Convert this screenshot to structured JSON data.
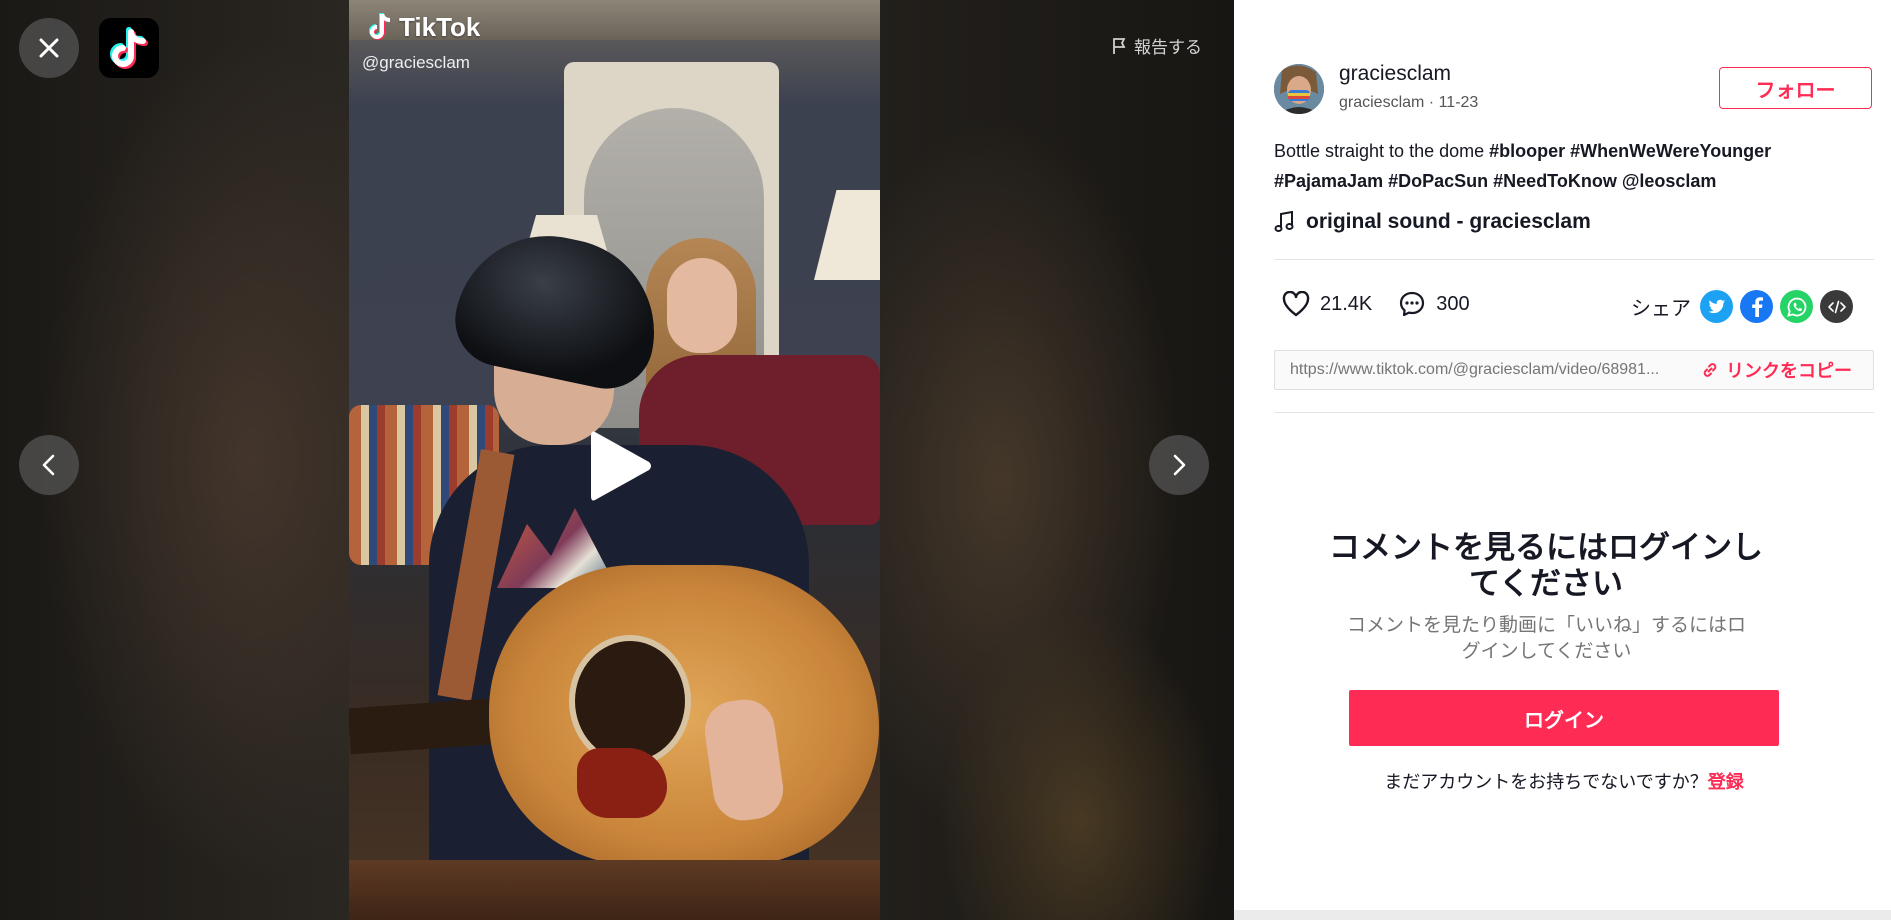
{
  "video": {
    "brand": "TikTok",
    "handle": "@graciesclam"
  },
  "report_label": "報告する",
  "author": {
    "username": "graciesclam",
    "subline": "graciesclam · 11-23",
    "follow_label": "フォロー"
  },
  "caption": {
    "text": "Bottle straight to the dome ",
    "tags": [
      "#blooper",
      "#WhenWeWereYounger",
      "#PajamaJam",
      "#DoPacSun",
      "#NeedToKnow",
      "@leosclam"
    ]
  },
  "sound": "original sound - graciesclam",
  "stats": {
    "likes": "21.4K",
    "comments": "300"
  },
  "share": {
    "label": "シェア",
    "icons": [
      "twitter-icon",
      "facebook-icon",
      "whatsapp-icon",
      "embed-icon"
    ],
    "colors": {
      "twitter": "#1da1f2",
      "facebook": "#1877f2",
      "whatsapp": "#25d366",
      "embed": "#3a3a3a"
    }
  },
  "link": {
    "url": "https://www.tiktok.com/@graciesclam/video/68981...",
    "copy_label": "リンクをコピー"
  },
  "login": {
    "title": "コメントを見るにはログインしてください",
    "subtitle": "コメントを見たり動画に「いいね」するにはログインしてください",
    "button": "ログイン",
    "signup_prompt": "まだアカウントをお持ちでないですか？",
    "signup_link": "登録"
  },
  "colors": {
    "accent": "#fe2c55",
    "text": "#161823"
  }
}
